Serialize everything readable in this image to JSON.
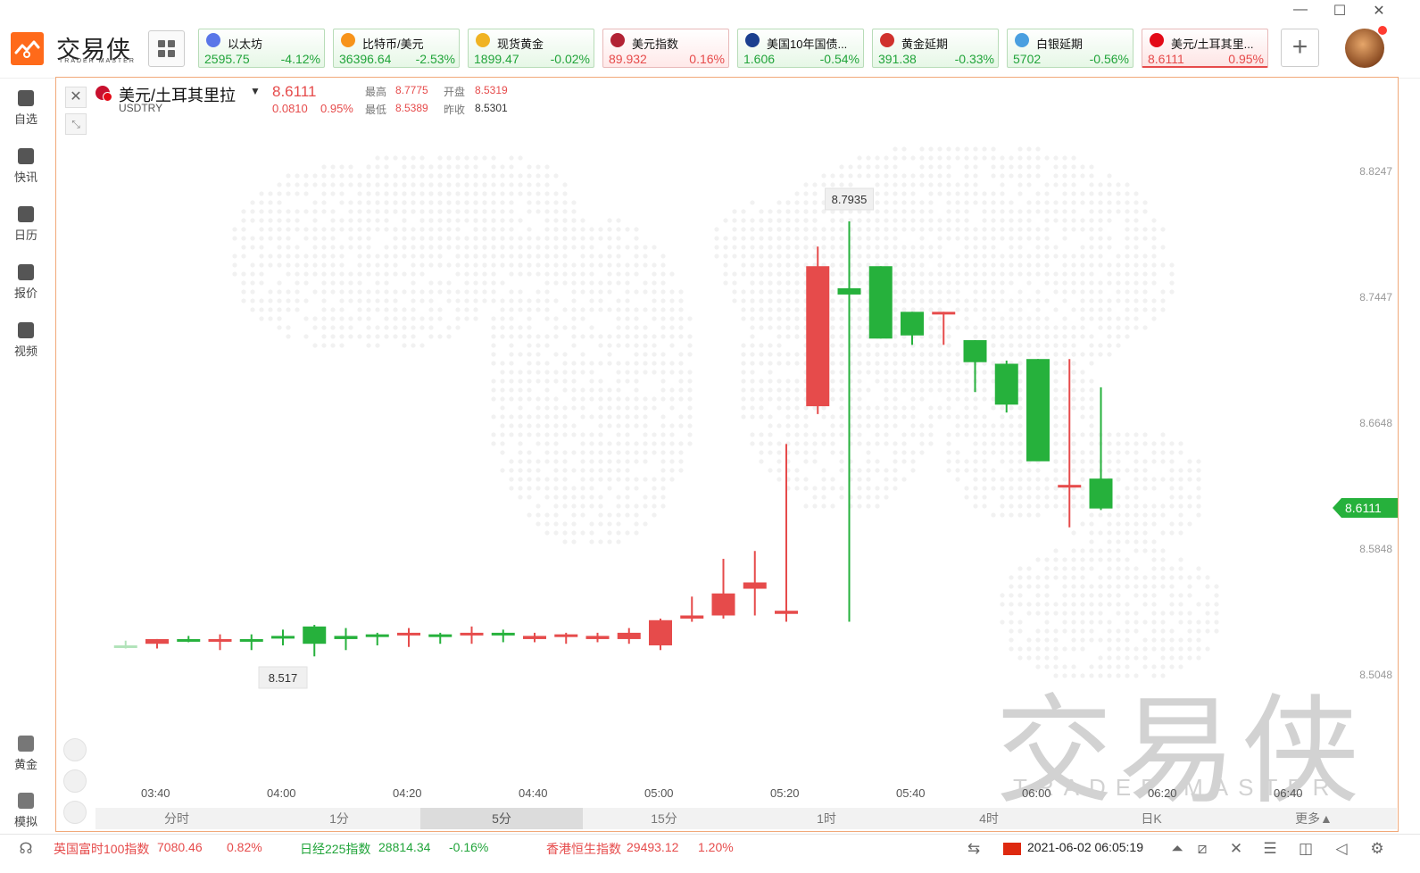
{
  "app": {
    "logo_text": "交易侠",
    "logo_sub": "TRADER MASTER",
    "win_min": "—",
    "win_max": "☐",
    "win_close": "✕"
  },
  "tickers": [
    {
      "name": "以太坊",
      "price": "2595.75",
      "change": "-4.12%",
      "trend": "down",
      "icon": "ethereum-icon",
      "color": "#5a76e8"
    },
    {
      "name": "比特币/美元",
      "price": "36396.64",
      "change": "-2.53%",
      "trend": "down",
      "icon": "bitcoin-icon",
      "color": "#f7931a"
    },
    {
      "name": "现货黄金",
      "price": "1899.47",
      "change": "-0.02%",
      "trend": "down",
      "icon": "gold-icon",
      "color": "#f0b323"
    },
    {
      "name": "美元指数",
      "price": "89.932",
      "change": "0.16%",
      "trend": "up",
      "icon": "us-flag-icon",
      "color": "#b22234"
    },
    {
      "name": "美国10年国债...",
      "price": "1.606",
      "change": "-0.54%",
      "trend": "down",
      "icon": "bond-icon",
      "color": "#1b3f8f"
    },
    {
      "name": "黄金延期",
      "price": "391.38",
      "change": "-0.33%",
      "trend": "down",
      "icon": "gold-deferred-icon",
      "color": "#d0312d"
    },
    {
      "name": "白银延期",
      "price": "5702",
      "change": "-0.56%",
      "trend": "down",
      "icon": "silver-deferred-icon",
      "color": "#4a9fe0"
    },
    {
      "name": "美元/土耳其里...",
      "price": "8.6111",
      "change": "0.95%",
      "trend": "up",
      "icon": "usdtry-flag-icon",
      "color": "#e30a17",
      "active": true
    }
  ],
  "add_label": "+",
  "sidebar": [
    {
      "label": "自选",
      "icon": "bookmark-icon"
    },
    {
      "label": "快讯",
      "icon": "news-icon"
    },
    {
      "label": "日历",
      "icon": "calendar-icon"
    },
    {
      "label": "报价",
      "icon": "quote-chart-icon"
    },
    {
      "label": "视频",
      "icon": "video-icon"
    }
  ],
  "sidebar_bottom": [
    {
      "label": "黄金",
      "icon": "gold-bar-icon"
    },
    {
      "label": "模拟",
      "icon": "wallet-icon"
    }
  ],
  "symbol": {
    "name": "美元/土耳其里拉",
    "code": "USDTRY",
    "price": "8.6111",
    "change": "0.0810",
    "change_pct": "0.95%",
    "high_label": "最高",
    "high": "8.7775",
    "open_label": "开盘",
    "open": "8.5319",
    "low_label": "最低",
    "low": "8.5389",
    "prev_label": "昨收",
    "prev": "8.5301"
  },
  "chart_data": {
    "type": "candlestick",
    "interval": "5分",
    "y_ticks": [
      "8.8247",
      "8.7447",
      "8.6648",
      "8.5848",
      "8.5048"
    ],
    "x_ticks": [
      "03:40",
      "04:00",
      "04:20",
      "04:40",
      "05:00",
      "05:20",
      "05:40",
      "06:00",
      "06:20",
      "06:40"
    ],
    "max_label": "8.7935",
    "min_label": "8.517",
    "current_price": "8.6111",
    "candles": [
      {
        "t": "03:35",
        "o": 8.524,
        "h": 8.527,
        "l": 8.522,
        "c": 8.523
      },
      {
        "t": "03:40",
        "o": 8.525,
        "h": 8.528,
        "l": 8.522,
        "c": 8.528
      },
      {
        "t": "03:45",
        "o": 8.528,
        "h": 8.53,
        "l": 8.526,
        "c": 8.527
      },
      {
        "t": "03:50",
        "o": 8.528,
        "h": 8.531,
        "l": 8.521,
        "c": 8.528
      },
      {
        "t": "03:55",
        "o": 8.528,
        "h": 8.531,
        "l": 8.521,
        "c": 8.527
      },
      {
        "t": "04:00",
        "o": 8.53,
        "h": 8.534,
        "l": 8.524,
        "c": 8.529
      },
      {
        "t": "04:05",
        "o": 8.536,
        "h": 8.537,
        "l": 8.517,
        "c": 8.525
      },
      {
        "t": "04:10",
        "o": 8.53,
        "h": 8.535,
        "l": 8.521,
        "c": 8.528
      },
      {
        "t": "04:15",
        "o": 8.531,
        "h": 8.532,
        "l": 8.524,
        "c": 8.53
      },
      {
        "t": "04:20",
        "o": 8.532,
        "h": 8.535,
        "l": 8.523,
        "c": 8.532
      },
      {
        "t": "04:25",
        "o": 8.531,
        "h": 8.532,
        "l": 8.525,
        "c": 8.53
      },
      {
        "t": "04:30",
        "o": 8.532,
        "h": 8.536,
        "l": 8.525,
        "c": 8.532
      },
      {
        "t": "04:35",
        "o": 8.532,
        "h": 8.534,
        "l": 8.526,
        "c": 8.531
      },
      {
        "t": "04:40",
        "o": 8.528,
        "h": 8.532,
        "l": 8.526,
        "c": 8.53
      },
      {
        "t": "04:45",
        "o": 8.53,
        "h": 8.532,
        "l": 8.525,
        "c": 8.531
      },
      {
        "t": "04:50",
        "o": 8.528,
        "h": 8.532,
        "l": 8.526,
        "c": 8.53
      },
      {
        "t": "04:55",
        "o": 8.528,
        "h": 8.535,
        "l": 8.525,
        "c": 8.532
      },
      {
        "t": "05:00",
        "o": 8.524,
        "h": 8.541,
        "l": 8.521,
        "c": 8.54
      },
      {
        "t": "05:05",
        "o": 8.541,
        "h": 8.555,
        "l": 8.539,
        "c": 8.543
      },
      {
        "t": "05:10",
        "o": 8.543,
        "h": 8.579,
        "l": 8.541,
        "c": 8.557
      },
      {
        "t": "05:15",
        "o": 8.56,
        "h": 8.584,
        "l": 8.543,
        "c": 8.564
      },
      {
        "t": "05:20",
        "o": 8.544,
        "h": 8.652,
        "l": 8.539,
        "c": 8.546
      },
      {
        "t": "05:25",
        "o": 8.676,
        "h": 8.7775,
        "l": 8.671,
        "c": 8.765
      },
      {
        "t": "05:30",
        "o": 8.751,
        "h": 8.7935,
        "l": 8.539,
        "c": 8.747
      },
      {
        "t": "05:35",
        "o": 8.765,
        "h": 8.765,
        "l": 8.719,
        "c": 8.719
      },
      {
        "t": "05:40",
        "o": 8.736,
        "h": 8.736,
        "l": 8.715,
        "c": 8.721
      },
      {
        "t": "05:45",
        "o": 8.736,
        "h": 8.736,
        "l": 8.715,
        "c": 8.736
      },
      {
        "t": "05:50",
        "o": 8.718,
        "h": 8.718,
        "l": 8.685,
        "c": 8.704
      },
      {
        "t": "05:55",
        "o": 8.703,
        "h": 8.705,
        "l": 8.672,
        "c": 8.677
      },
      {
        "t": "06:00",
        "o": 8.706,
        "h": 8.706,
        "l": 8.655,
        "c": 8.641
      },
      {
        "t": "06:05",
        "o": 8.625,
        "h": 8.706,
        "l": 8.599,
        "c": 8.626
      },
      {
        "t": "06:10",
        "o": 8.63,
        "h": 8.688,
        "l": 8.61,
        "c": 8.611
      }
    ]
  },
  "watermark": {
    "cn": "交易侠",
    "en": "TRADER MASTER"
  },
  "periods": [
    "分时",
    "1分",
    "5分",
    "15分",
    "1时",
    "4时",
    "日K",
    "更多▲"
  ],
  "active_period": "5分",
  "status": {
    "ftse_label": "英国富时100指数",
    "ftse_value": "7080.46",
    "ftse_change": "0.82%",
    "nikkei_label": "日经225指数",
    "nikkei_value": "28814.34",
    "nikkei_change": "-0.16%",
    "hsi_label": "香港恒生指数",
    "hsi_value": "29493.12",
    "hsi_change": "1.20%",
    "datetime": "2021-06-02 06:05:19"
  }
}
